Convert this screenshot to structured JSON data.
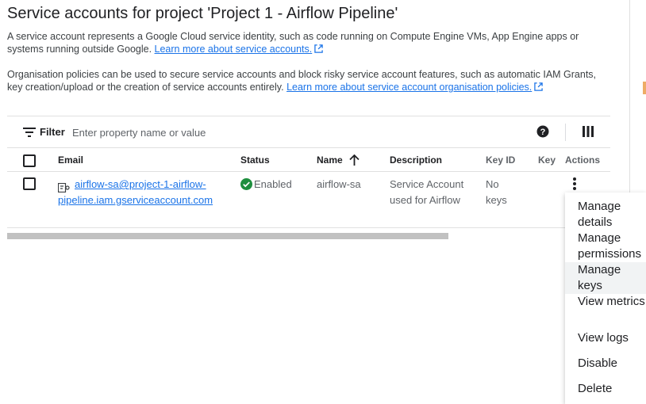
{
  "page": {
    "title": "Service accounts for project 'Project 1 - Airflow Pipeline'",
    "intro_text": "A service account represents a Google Cloud service identity, such as code running on Compute Engine VMs, App Engine apps or systems running outside Google.",
    "intro_link": "Learn more about service accounts.",
    "policy_text": "Organisation policies can be used to secure service accounts and block risky service account features, such as automatic IAM Grants, key creation/upload or the creation of service accounts entirely.",
    "policy_link": "Learn more about service account organisation policies."
  },
  "filter": {
    "label": "Filter",
    "placeholder": "Enter property name or value"
  },
  "table": {
    "headers": {
      "email": "Email",
      "status": "Status",
      "name": "Name",
      "description": "Description",
      "key_id": "Key ID",
      "key_created": "Key",
      "actions": "Actions"
    },
    "rows": [
      {
        "email": "airflow-sa@project-1-airflow-pipeline.iam.gserviceaccount.com",
        "status": "Enabled",
        "name": "airflow-sa",
        "description": "Service Account used for Airflow",
        "key_id": "No keys"
      }
    ]
  },
  "actions_menu": {
    "items": [
      "Manage details",
      "Manage permissions",
      "Manage keys",
      "View metrics",
      "View logs",
      "Disable",
      "Delete"
    ]
  },
  "colors": {
    "link": "#1a73e8",
    "enabled": "#1e8e3e",
    "text": "#202124"
  },
  "icons": [
    "external-link-icon",
    "filter-icon",
    "help-icon",
    "column-display-icon",
    "sort-arrow-up-icon",
    "service-account-key-icon",
    "check-circle-icon",
    "more-vert-icon"
  ]
}
